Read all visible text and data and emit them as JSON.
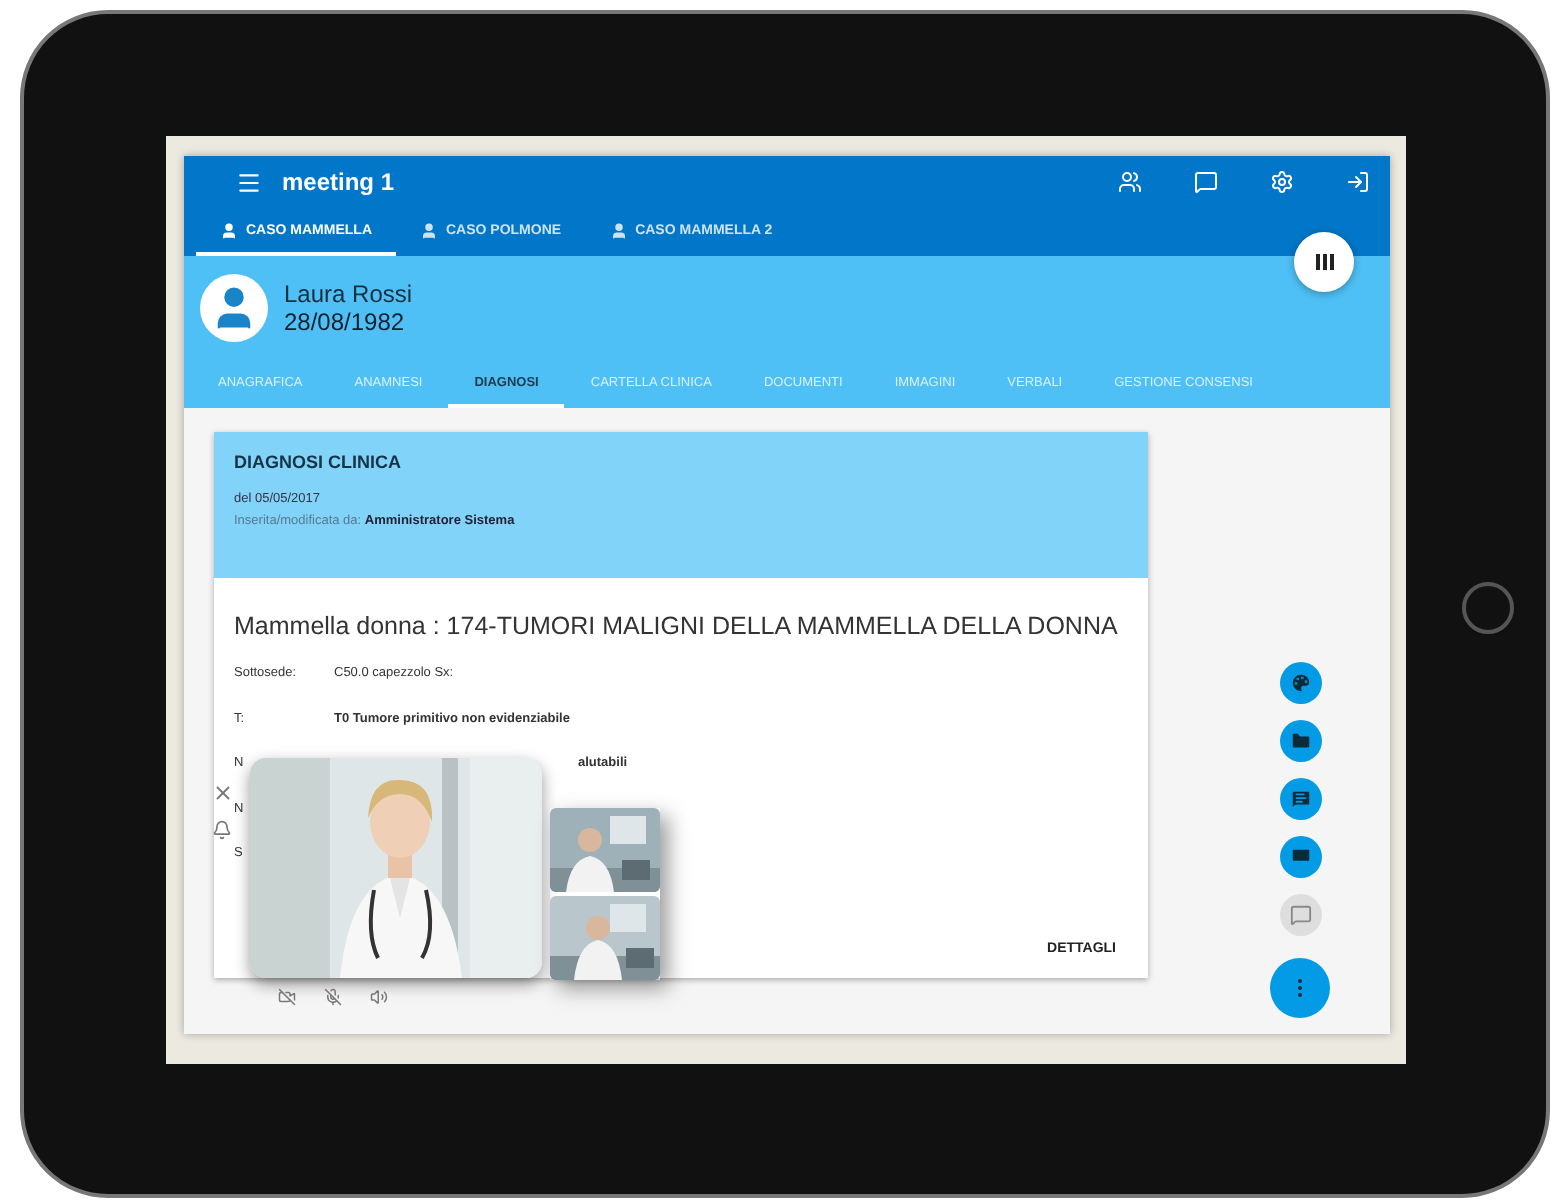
{
  "app_bar": {
    "title": "meeting 1"
  },
  "case_tabs": [
    {
      "label": "CASO MAMMELLA",
      "selected": true
    },
    {
      "label": "CASO POLMONE",
      "selected": false
    },
    {
      "label": "CASO MAMMELLA 2",
      "selected": false
    }
  ],
  "patient": {
    "name": "Laura Rossi",
    "birth_date": "28/08/1982"
  },
  "section_tabs": [
    {
      "label": "ANAGRAFICA",
      "selected": false
    },
    {
      "label": "ANAMNESI",
      "selected": false
    },
    {
      "label": "DIAGNOSI",
      "selected": true
    },
    {
      "label": "CARTELLA CLINICA",
      "selected": false
    },
    {
      "label": "DOCUMENTI",
      "selected": false
    },
    {
      "label": "IMMAGINI",
      "selected": false
    },
    {
      "label": "VERBALI",
      "selected": false
    },
    {
      "label": "GESTIONE CONSENSI",
      "selected": false
    }
  ],
  "card": {
    "title": "DIAGNOSI CLINICA",
    "date": "del 05/05/2017",
    "author_label": "Inserita/modificata da:",
    "author": "Amministratore Sistema",
    "diagnosis": "Mammella donna : 174-TUMORI MALIGNI DELLA MAMMELLA DELLA DONNA",
    "rows": [
      {
        "kind": "full",
        "label": "Sottosede:",
        "value": "C50.0 capezzolo Sx:"
      },
      {
        "kind": "full",
        "label": "T:",
        "value": "T0 Tumore primitivo non evidenziabile"
      },
      {
        "kind": "partial",
        "label": "N",
        "value": "alutabili"
      },
      {
        "kind": "partial",
        "label": "N"
      },
      {
        "kind": "partial",
        "label": "S"
      }
    ],
    "action": "DETTAGLI"
  },
  "quick_actions": [
    {
      "kind": "palette",
      "disabled": false
    },
    {
      "kind": "folder",
      "disabled": false
    },
    {
      "kind": "chat",
      "disabled": false
    },
    {
      "kind": "screen",
      "disabled": false
    },
    {
      "kind": "comment",
      "disabled": true
    }
  ]
}
